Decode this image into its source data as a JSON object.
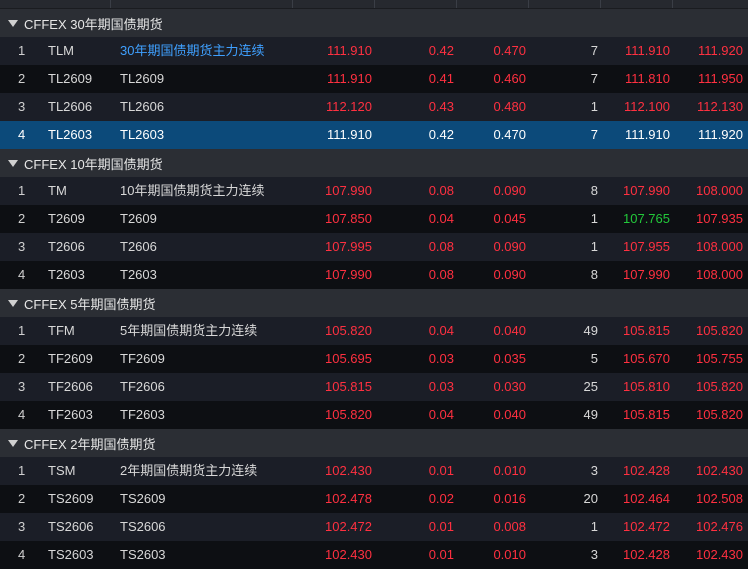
{
  "colors": {
    "up": "#ff3040",
    "down": "#22c83a",
    "link": "#3fa0ff",
    "selected_row": "#0c4a7a"
  },
  "groups": [
    {
      "title": "CFFEX 30年期国债期货",
      "rows": [
        {
          "idx": "1",
          "code": "TLM",
          "name": "30年期国债期货主力连续",
          "last": "111.910",
          "chg": "0.42",
          "pct": "0.470",
          "vol": "7",
          "bid": "111.910",
          "ask": "111.920"
        },
        {
          "idx": "2",
          "code": "TL2609",
          "name": "TL2609",
          "last": "111.910",
          "chg": "0.41",
          "pct": "0.460",
          "vol": "7",
          "bid": "111.810",
          "ask": "111.950"
        },
        {
          "idx": "3",
          "code": "TL2606",
          "name": "TL2606",
          "last": "112.120",
          "chg": "0.43",
          "pct": "0.480",
          "vol": "1",
          "bid": "112.100",
          "ask": "112.130"
        },
        {
          "idx": "4",
          "code": "TL2603",
          "name": "TL2603",
          "last": "111.910",
          "chg": "0.42",
          "pct": "0.470",
          "vol": "7",
          "bid": "111.910",
          "ask": "111.920"
        }
      ]
    },
    {
      "title": "CFFEX 10年期国债期货",
      "rows": [
        {
          "idx": "1",
          "code": "TM",
          "name": "10年期国债期货主力连续",
          "last": "107.990",
          "chg": "0.08",
          "pct": "0.090",
          "vol": "8",
          "bid": "107.990",
          "ask": "108.000"
        },
        {
          "idx": "2",
          "code": "T2609",
          "name": "T2609",
          "last": "107.850",
          "chg": "0.04",
          "pct": "0.045",
          "vol": "1",
          "bid": "107.765",
          "ask": "107.935"
        },
        {
          "idx": "3",
          "code": "T2606",
          "name": "T2606",
          "last": "107.995",
          "chg": "0.08",
          "pct": "0.090",
          "vol": "1",
          "bid": "107.955",
          "ask": "108.000"
        },
        {
          "idx": "4",
          "code": "T2603",
          "name": "T2603",
          "last": "107.990",
          "chg": "0.08",
          "pct": "0.090",
          "vol": "8",
          "bid": "107.990",
          "ask": "108.000"
        }
      ]
    },
    {
      "title": "CFFEX 5年期国债期货",
      "rows": [
        {
          "idx": "1",
          "code": "TFM",
          "name": "5年期国债期货主力连续",
          "last": "105.820",
          "chg": "0.04",
          "pct": "0.040",
          "vol": "49",
          "bid": "105.815",
          "ask": "105.820"
        },
        {
          "idx": "2",
          "code": "TF2609",
          "name": "TF2609",
          "last": "105.695",
          "chg": "0.03",
          "pct": "0.035",
          "vol": "5",
          "bid": "105.670",
          "ask": "105.755"
        },
        {
          "idx": "3",
          "code": "TF2606",
          "name": "TF2606",
          "last": "105.815",
          "chg": "0.03",
          "pct": "0.030",
          "vol": "25",
          "bid": "105.810",
          "ask": "105.820"
        },
        {
          "idx": "4",
          "code": "TF2603",
          "name": "TF2603",
          "last": "105.820",
          "chg": "0.04",
          "pct": "0.040",
          "vol": "49",
          "bid": "105.815",
          "ask": "105.820"
        }
      ]
    },
    {
      "title": "CFFEX 2年期国债期货",
      "rows": [
        {
          "idx": "1",
          "code": "TSM",
          "name": "2年期国债期货主力连续",
          "last": "102.430",
          "chg": "0.01",
          "pct": "0.010",
          "vol": "3",
          "bid": "102.428",
          "ask": "102.430"
        },
        {
          "idx": "2",
          "code": "TS2609",
          "name": "TS2609",
          "last": "102.478",
          "chg": "0.02",
          "pct": "0.016",
          "vol": "20",
          "bid": "102.464",
          "ask": "102.508"
        },
        {
          "idx": "3",
          "code": "TS2606",
          "name": "TS2606",
          "last": "102.472",
          "chg": "0.01",
          "pct": "0.008",
          "vol": "1",
          "bid": "102.472",
          "ask": "102.476"
        },
        {
          "idx": "4",
          "code": "TS2603",
          "name": "TS2603",
          "last": "102.430",
          "chg": "0.01",
          "pct": "0.010",
          "vol": "3",
          "bid": "102.428",
          "ask": "102.430"
        }
      ]
    }
  ]
}
